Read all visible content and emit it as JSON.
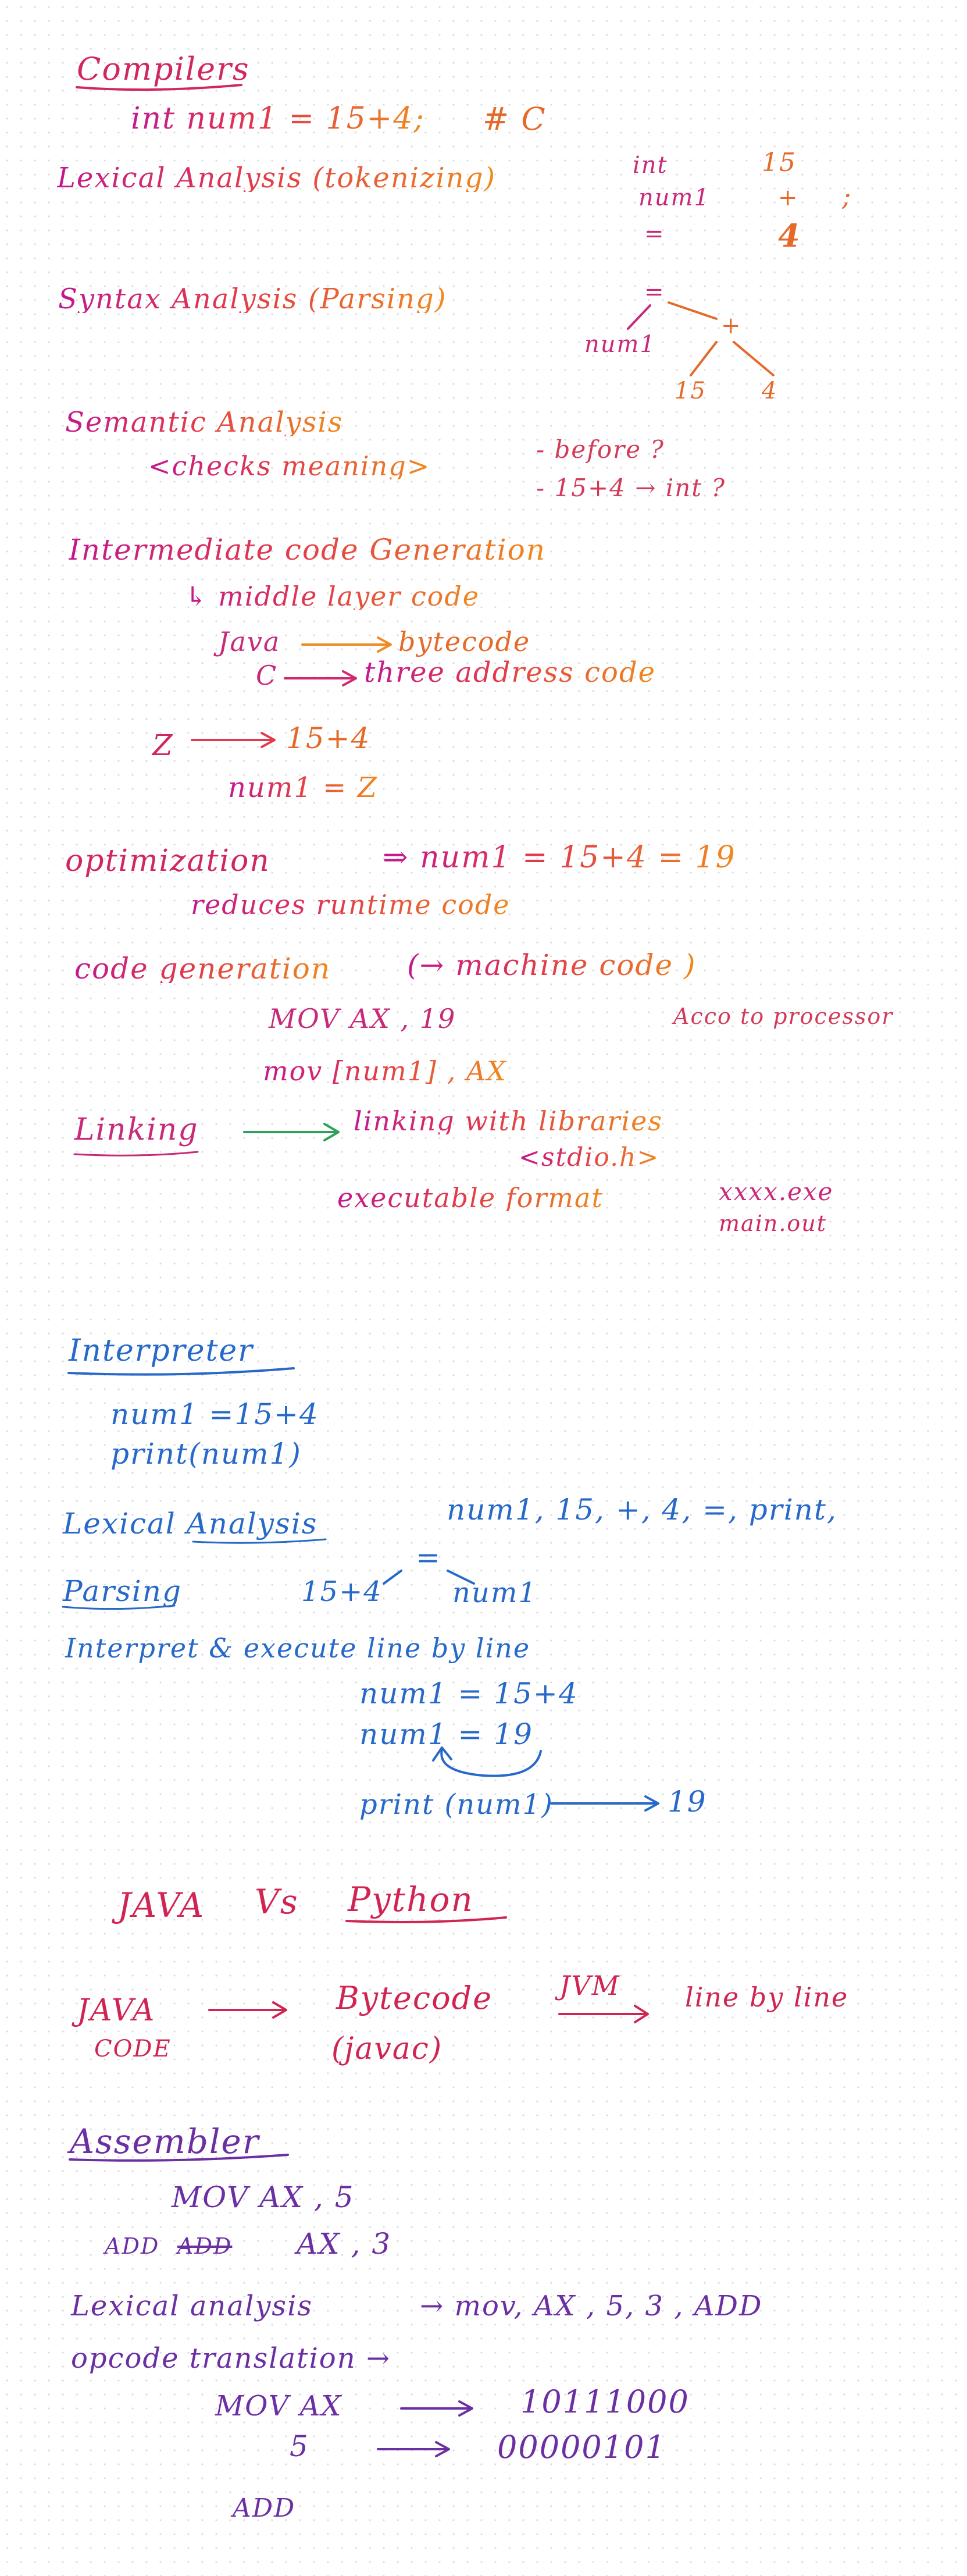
{
  "compilers": {
    "title": "Compilers",
    "code_line": "int num1 = 15+4;",
    "lang_tag": "# C",
    "lexical": {
      "label": "Lexical Analysis (tokenizing)",
      "tokens": [
        "int",
        "15",
        "num1",
        "+",
        ";",
        "=",
        "4"
      ]
    },
    "syntax": {
      "label": "Syntax Analysis (Parsing)",
      "tree": [
        "=",
        "+",
        "num1",
        "15",
        "4"
      ]
    },
    "semantic": {
      "label": "Semantic Analysis",
      "sub": "<checks meaning>",
      "q1": "- before ?",
      "q2": "- 15+4 → int ?"
    },
    "intermediate": {
      "label": "Intermediate code Generation",
      "l1": "↳ middle layer code",
      "java_left": "Java",
      "java_right": "bytecode",
      "c_left": "C",
      "c_right": "three address code",
      "z1_left": "Z",
      "z1_right": "15+4",
      "z2": "num1  = Z"
    },
    "optimization": {
      "label": "optimization",
      "expr": "⇒ num1 = 15+4  =  19",
      "sub": "reduces  runtime  code"
    },
    "codegen": {
      "label": "code generation",
      "paren": "(→ machine code )",
      "l1": "MOV  AX  , 19",
      "note": "Acco to processor",
      "l2": "mov  [num1] , AX"
    },
    "linking": {
      "label": "Linking",
      "l1": "linking with libraries",
      "l2": "<stdio.h>",
      "l3": "executable  format",
      "f1": "xxxx.exe",
      "f2": "main.out"
    }
  },
  "interpreter": {
    "title": "Interpreter",
    "code1": "num1 =15+4",
    "code2": "print(num1)",
    "lexical_label": "Lexical Analysis",
    "lexical_tokens": "num1, 15, +, 4, =, print,",
    "parsing_label": "Parsing",
    "parse_left": "15+4",
    "parse_eq": "=",
    "parse_right": "num1",
    "interpret_label": "Interpret & execute line by line",
    "s1": "num1 = 15+4",
    "s2": "num1 = 19",
    "s3_left": "print (num1)",
    "s3_right": "19"
  },
  "java_vs_python": {
    "title_left": "JAVA",
    "title_vs": "Vs",
    "title_right": "Python",
    "java": "JAVA",
    "code": "CODE",
    "bytecode": "Bytecode",
    "javac": "(javac)",
    "jvm": "JVM",
    "tail": "line by line"
  },
  "assembler": {
    "title": "Assembler",
    "l1": "MOV AX , 5",
    "l2_prefix": "ADD",
    "l2_struck": "ADD",
    "l2": "AX , 3",
    "lexical": "Lexical analysis",
    "lexical_tokens": "→ mov, AX , 5, 3 , ADD",
    "opcode": "opcode translation →",
    "m1_left": "MOV AX",
    "m1_right": "10111000",
    "m2_left": "5",
    "m2_right": "00000101",
    "m3_left": "ADD"
  }
}
